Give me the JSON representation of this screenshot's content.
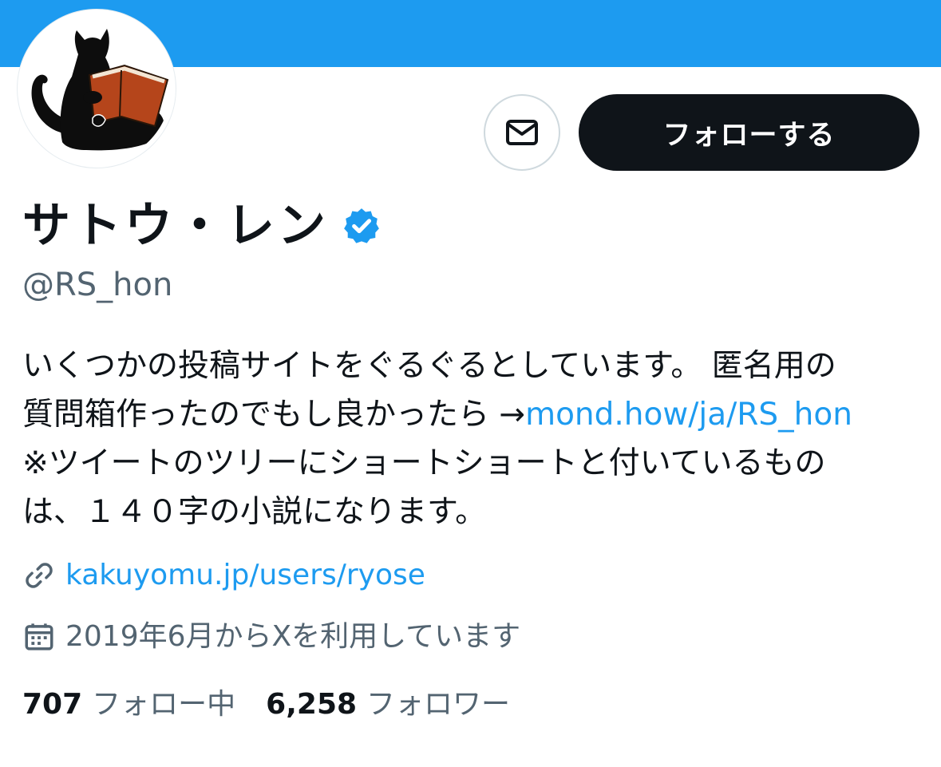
{
  "profile": {
    "display_name": "サトウ・レン",
    "handle": "@RS_hon",
    "verified_icon": "verified-badge-icon",
    "bio_lines": [
      "いくつかの投稿サイトをぐるぐるとしています。 匿名用の",
      "質問箱作ったのでもし良かったら →",
      "※ツイートのツリーにショートショートと付いているもの",
      "は、１４０字の小説になります。"
    ],
    "bio_link": "mond.how/ja/RS_hon",
    "website": "kakuyomu.jp/users/ryose",
    "joined": "2019年6月からXを利用しています"
  },
  "actions": {
    "message_icon": "envelope-icon",
    "follow_label": "フォローする"
  },
  "stats": {
    "following_count": "707",
    "following_label": "フォロー中",
    "followers_count": "6,258",
    "followers_label": "フォロワー"
  },
  "colors": {
    "banner": "#1d9bf0",
    "link": "#1d9bf0",
    "secondary_text": "#536471",
    "follow_button": "#0f1419"
  }
}
